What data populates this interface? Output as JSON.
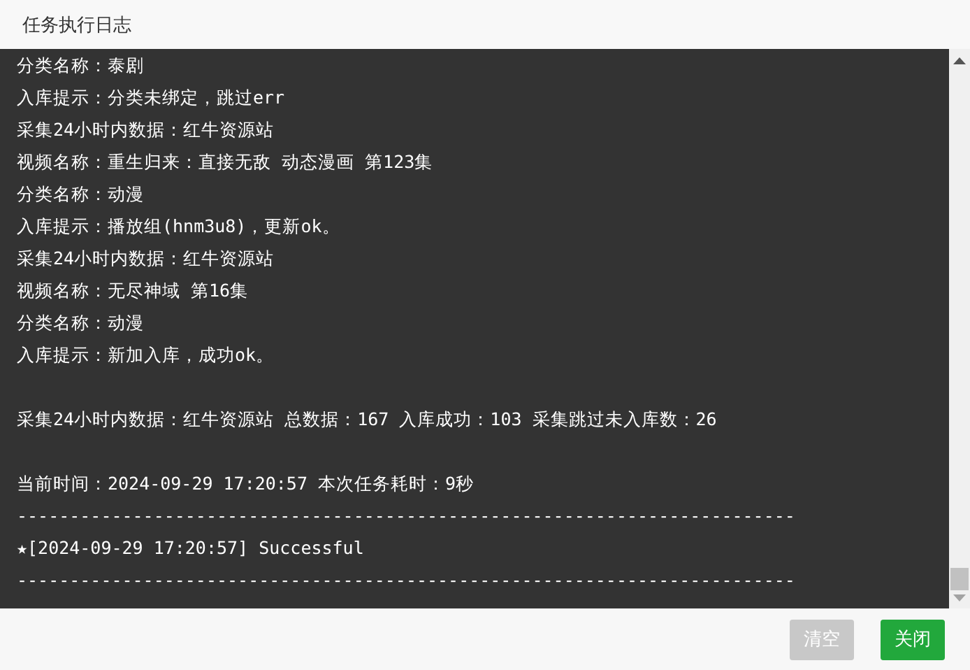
{
  "window": {
    "title": "任务执行日志"
  },
  "log_blocks": [
    [
      "分类名称：泰剧",
      "入库提示：分类未绑定，跳过err",
      "采集24小时内数据：红牛资源站",
      "视频名称：重生归来：直接无敌 动态漫画 第123集",
      "分类名称：动漫",
      "入库提示：播放组(hnm3u8)，更新ok。",
      "采集24小时内数据：红牛资源站",
      "视频名称：无尽神域 第16集",
      "分类名称：动漫",
      "入库提示：新加入库，成功ok。"
    ],
    [
      "采集24小时内数据：红牛资源站 总数据：167 入库成功：103 采集跳过未入库数：26"
    ],
    [
      "当前时间：2024-09-29 17:20:57 本次任务耗时：9秒",
      "--------------------------------------------------------------------------",
      "★[2024-09-29 17:20:57] Successful",
      "--------------------------------------------------------------------------"
    ]
  ],
  "buttons": [
    {
      "label": "清空",
      "disabled": true,
      "kind": "secondary"
    },
    {
      "label": "关闭",
      "disabled": false,
      "kind": "primary"
    }
  ]
}
